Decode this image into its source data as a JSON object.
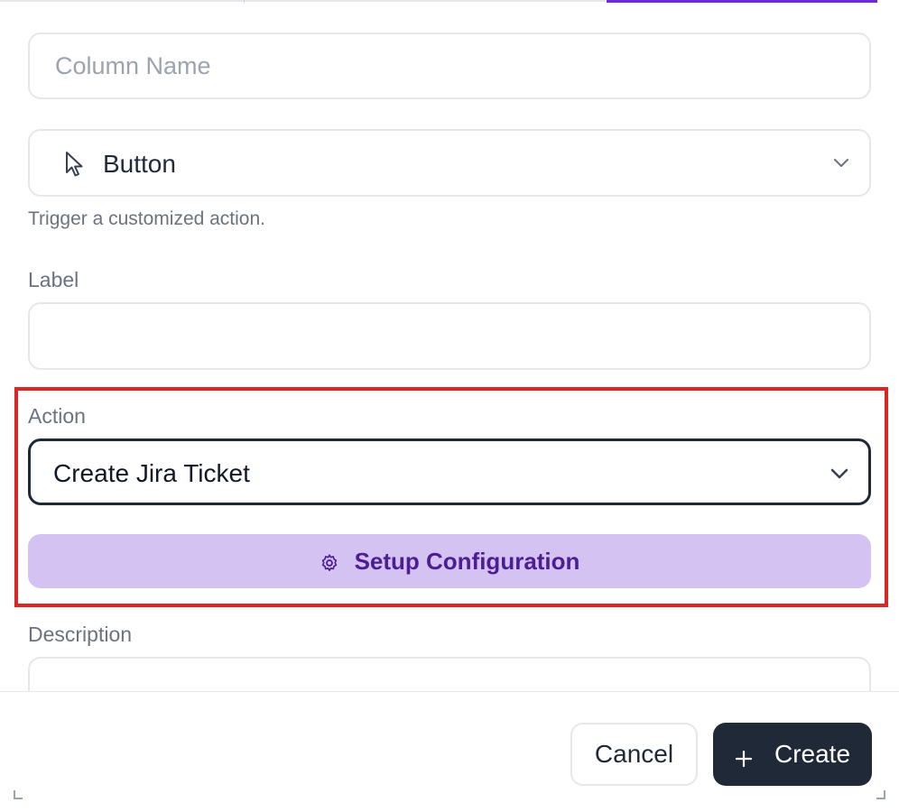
{
  "form": {
    "column_name": {
      "placeholder": "Column Name",
      "value": ""
    },
    "type_select": {
      "value": "Button",
      "icon": "cursor-pointer-icon"
    },
    "type_helper": "Trigger a customized action.",
    "label_field": {
      "label": "Label",
      "value": ""
    },
    "action_field": {
      "label": "Action",
      "value": "Create Jira Ticket"
    },
    "setup_button": {
      "label": "Setup Configuration",
      "icon": "gear-icon"
    },
    "description_field": {
      "label": "Description",
      "value": ""
    }
  },
  "footer": {
    "cancel_label": "Cancel",
    "create_label": "Create",
    "create_icon": "plus-icon"
  },
  "colors": {
    "accent": "#6d28d9",
    "setup_button_bg": "#d4c2f2",
    "setup_button_text": "#4c1d95",
    "primary_button_bg": "#1f2937",
    "highlight_border": "#dc2626"
  }
}
